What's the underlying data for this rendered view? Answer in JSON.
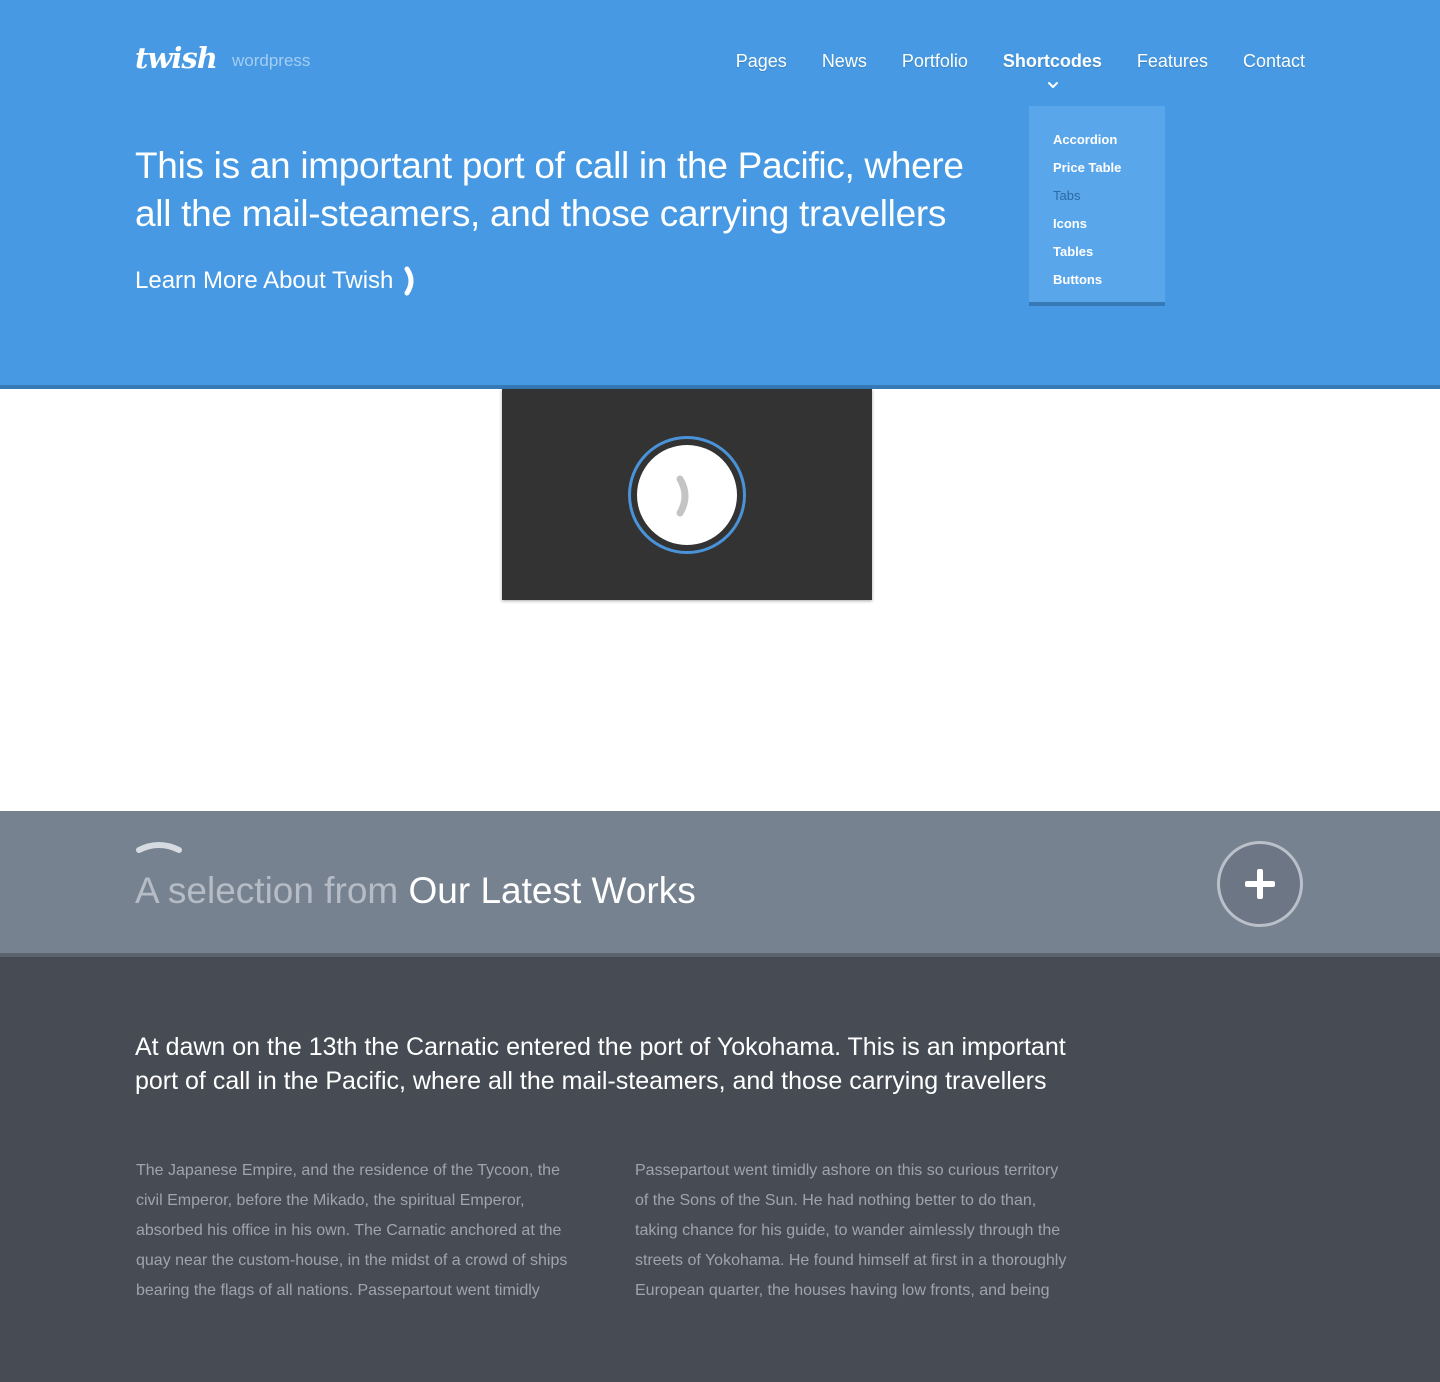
{
  "brand": {
    "name": "twish",
    "tagline": "wordpress"
  },
  "nav": {
    "items": [
      "Pages",
      "News",
      "Portfolio",
      "Shortcodes",
      "Features",
      "Contact"
    ],
    "active": "Shortcodes",
    "dropdown": [
      "Accordion",
      "Price Table",
      "Tabs",
      "Icons",
      "Tables",
      "Buttons"
    ]
  },
  "hero": {
    "title": "This is an important port of call in the Pacific, where all the mail-steamers, and those carrying travellers",
    "link_label": "Learn More About Twish"
  },
  "media": {
    "icon": "play-icon"
  },
  "works": {
    "title_light": "A selection from",
    "title_strong": "Our Latest Works",
    "button_icon": "plus-icon"
  },
  "content": {
    "lead": "At dawn on the 13th the Carnatic entered the port of Yokohama.  This is an important port of call in the Pacific, where all the mail-steamers, and those carrying travellers",
    "col_left": "The Japanese Empire, and the residence of the Tycoon, the civil Emperor, before the Mikado, the spiritual Emperor, absorbed his office in his own.  The Carnatic anchored at the quay near the custom-house, in the midst of a crowd of ships bearing the flags of all nations. Passepartout went timidly",
    "col_right": "Passepartout went timidly ashore on this so curious territory of the Sons of the Sun.  He had nothing better to do than, taking chance for his guide, to wander aimlessly through the streets of Yokohama.  He found himself at first in a thoroughly European quarter, the houses having low fronts, and being"
  },
  "colors": {
    "hero_bg": "#4699e2",
    "accent_dark": "#3579b6",
    "works_bg": "#778290",
    "content_bg": "#474c54",
    "media_bg": "#333333"
  }
}
